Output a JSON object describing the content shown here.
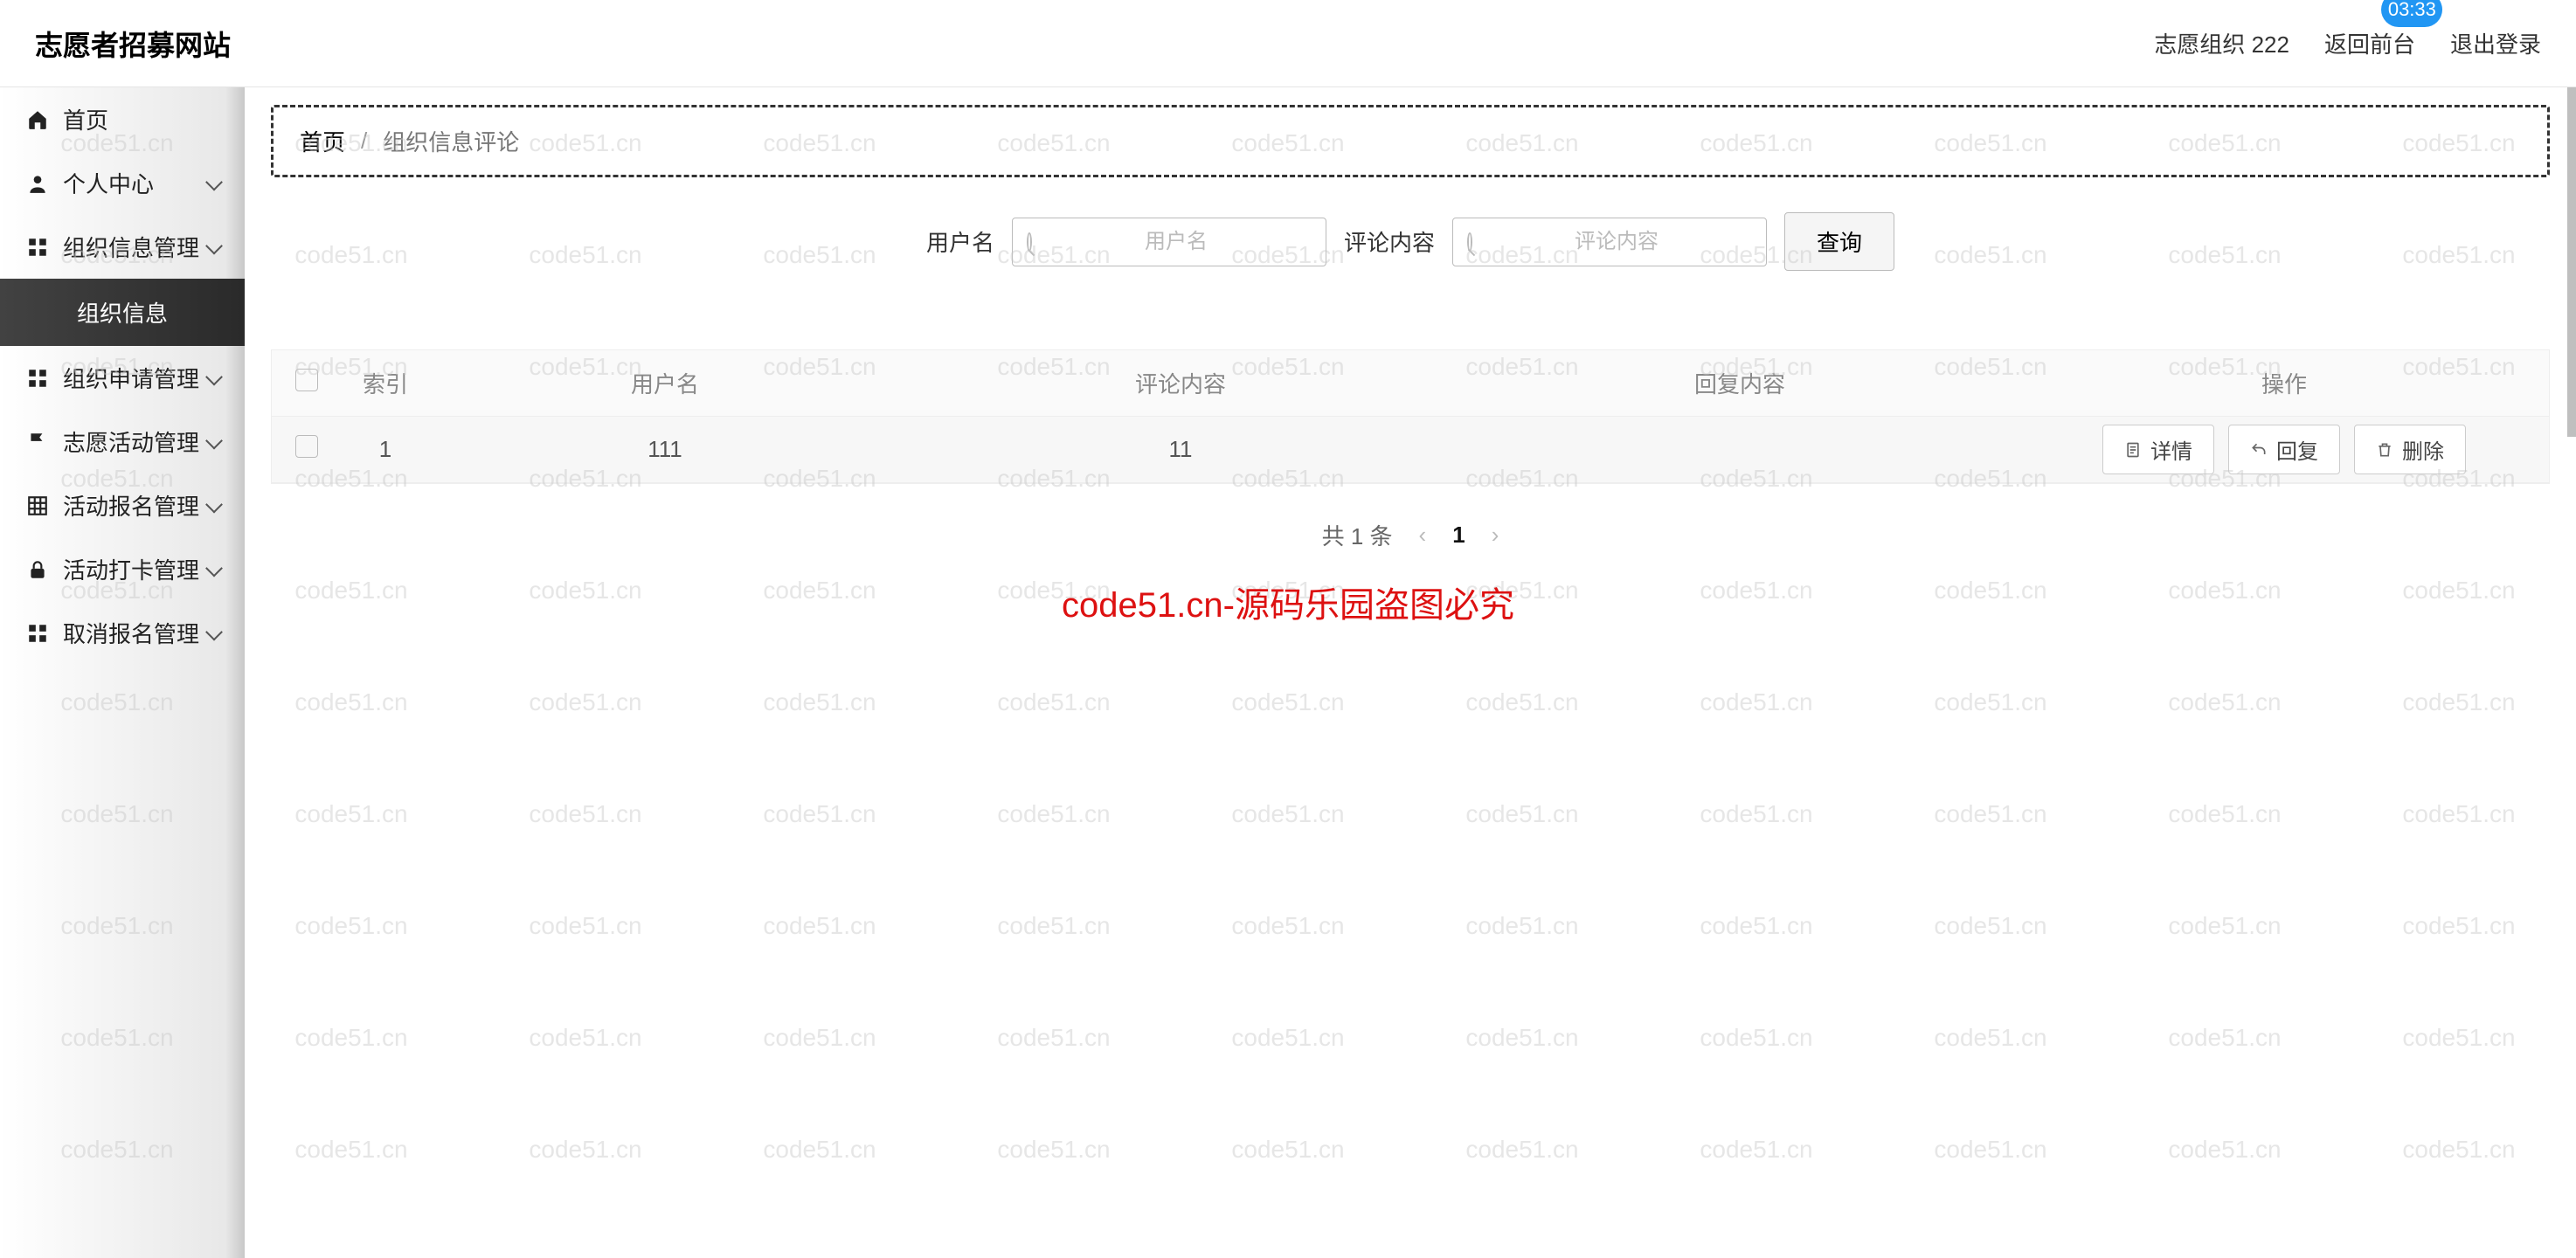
{
  "header": {
    "title": "志愿者招募网站",
    "org_label": "志愿组织 222",
    "to_front": "返回前台",
    "logout": "退出登录",
    "badge_time": "03:33"
  },
  "sidebar": {
    "items": [
      {
        "label": "首页",
        "icon": "home-icon",
        "has_sub": false
      },
      {
        "label": "个人中心",
        "icon": "user-icon",
        "has_sub": true
      },
      {
        "label": "组织信息管理",
        "icon": "grid-icon",
        "has_sub": true
      },
      {
        "label": "组织申请管理",
        "icon": "grid-icon",
        "has_sub": true
      },
      {
        "label": "志愿活动管理",
        "icon": "flag-icon",
        "has_sub": true
      },
      {
        "label": "活动报名管理",
        "icon": "table-icon",
        "has_sub": true
      },
      {
        "label": "活动打卡管理",
        "icon": "lock-icon",
        "has_sub": true
      },
      {
        "label": "取消报名管理",
        "icon": "grid-icon",
        "has_sub": true
      }
    ],
    "active_sub": "组织信息"
  },
  "breadcrumb": {
    "home": "首页",
    "current": "组织信息评论"
  },
  "search": {
    "user_label": "用户名",
    "user_placeholder": "用户名",
    "comment_label": "评论内容",
    "comment_placeholder": "评论内容",
    "query_btn": "查询"
  },
  "table": {
    "cols": {
      "idx": "索引",
      "user": "用户名",
      "content": "评论内容",
      "reply": "回复内容",
      "ops": "操作"
    },
    "rows": [
      {
        "idx": "1",
        "user": "111",
        "content": "11",
        "reply": ""
      }
    ],
    "ops": {
      "detail": "详情",
      "reply": "回复",
      "delete": "删除"
    }
  },
  "pagination": {
    "total_text": "共 1 条",
    "current": "1"
  },
  "watermark": {
    "cell": "code51.cn",
    "center": "code51.cn-源码乐园盗图必究"
  }
}
